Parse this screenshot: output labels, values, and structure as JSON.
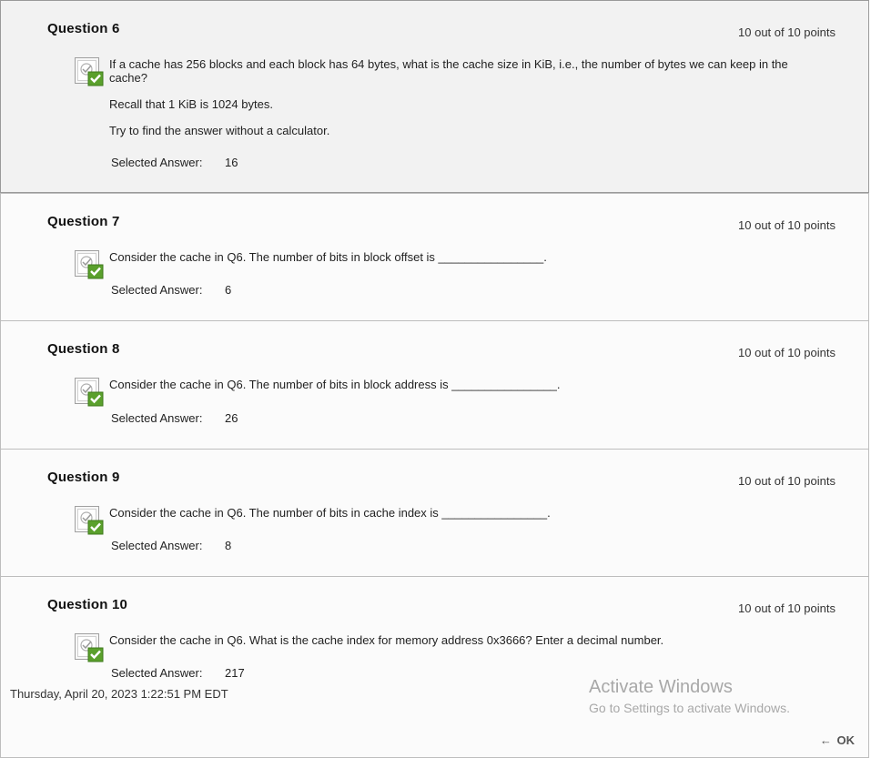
{
  "questions": [
    {
      "title": "Question 6",
      "points": "10 out of 10 points",
      "paragraphs": [
        "If a cache has 256 blocks and each block has 64 bytes, what is the cache size in KiB, i.e., the number of bytes we can keep in the cache?",
        "Recall that 1 KiB is 1024 bytes.",
        "Try to find the answer without a calculator."
      ],
      "answer_label": "Selected Answer:",
      "answer_value": "16",
      "status_icon": "correct-check-icon"
    },
    {
      "title": "Question 7",
      "points": "10 out of 10 points",
      "paragraphs": [
        "Consider the cache in Q6. The number of bits in block offset is ________________."
      ],
      "answer_label": "Selected Answer:",
      "answer_value": "6",
      "status_icon": "correct-check-icon"
    },
    {
      "title": "Question 8",
      "points": "10 out of 10 points",
      "paragraphs": [
        "Consider the cache in Q6. The number of bits in block address is ________________."
      ],
      "answer_label": "Selected Answer:",
      "answer_value": "26",
      "status_icon": "correct-check-icon"
    },
    {
      "title": "Question 9",
      "points": "10 out of 10 points",
      "paragraphs": [
        "Consider the cache in Q6. The number of bits in cache index is ________________."
      ],
      "answer_label": "Selected Answer:",
      "answer_value": "8",
      "status_icon": "correct-check-icon"
    },
    {
      "title": "Question 10",
      "points": "10 out of 10 points",
      "paragraphs": [
        "Consider the cache in Q6. What is the cache index for memory address 0x3666? Enter a decimal number."
      ],
      "answer_label": "Selected Answer:",
      "answer_value": "217",
      "status_icon": "correct-check-icon"
    }
  ],
  "footer": {
    "timestamp": "Thursday, April 20, 2023 1:22:51 PM EDT",
    "ok_arrow": "←",
    "ok_label": "OK"
  },
  "watermark": {
    "title": "Activate Windows",
    "subtitle": "Go to Settings to activate Windows."
  },
  "colors": {
    "check_green": "#5aa02c",
    "selected_bg": "#f2f2f2",
    "watermark_gray": "#a8a8a8"
  }
}
